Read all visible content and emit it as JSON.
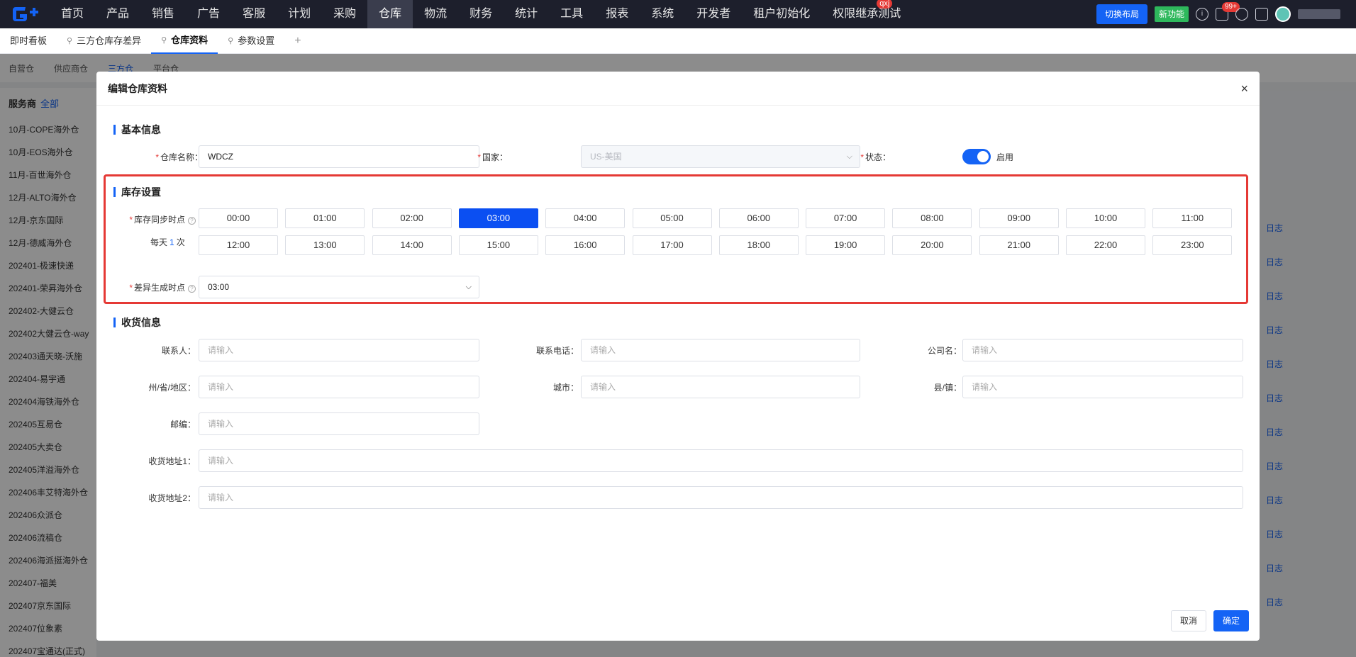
{
  "nav": {
    "items": [
      "首页",
      "产品",
      "销售",
      "广告",
      "客服",
      "计划",
      "采购",
      "仓库",
      "物流",
      "财务",
      "统计",
      "工具",
      "报表",
      "系统",
      "开发者",
      "租户初始化",
      "权限继承测试"
    ],
    "active_index": 7,
    "qxj_badge": "qxj",
    "switch_layout": "切换布局",
    "new_feature": "新功能",
    "notify_badge": "99+"
  },
  "tabs": {
    "items": [
      "即时看板",
      "三方仓库存差异",
      "仓库资料",
      "参数设置"
    ],
    "add": "+"
  },
  "subtabs": [
    "自营仓",
    "供应商仓",
    "三方仓",
    "平台仓"
  ],
  "sidebar": {
    "title": "服务商",
    "all": "全部",
    "items": [
      "10月-COPE海外仓",
      "10月-EOS海外仓",
      "11月-百世海外仓",
      "12月-ALTO海外仓",
      "12月-京东国际",
      "12月-德威海外仓",
      "202401-极速快递",
      "202401-荣昇海外仓",
      "202402-大健云仓",
      "202402大健云仓-way",
      "202403通天晓-沃施",
      "202404-易宇通",
      "202404海铁海外仓",
      "202405互易仓",
      "202405大卖仓",
      "202405洋溢海外仓",
      "202406丰艾特海外仓",
      "202406众派仓",
      "202406流稿仓",
      "202406海派挺海外仓",
      "202407-福美",
      "202407京东国际",
      "202407位象素",
      "202407宝通达(正式)"
    ]
  },
  "bg_log_label": "日志",
  "modal": {
    "title": "编辑仓库资料",
    "close": "×",
    "basic": {
      "section": "基本信息",
      "name_label": "仓库名称：",
      "name_value": "WDCZ",
      "country_label": "国家：",
      "country_value": "US-美国",
      "status_label": "状态：",
      "status_value": "启用"
    },
    "stock": {
      "section": "库存设置",
      "sync_label": "库存同步时点",
      "per_day_prefix": "每天",
      "per_day_count": "1",
      "per_day_suffix": "次",
      "times": [
        "00:00",
        "01:00",
        "02:00",
        "03:00",
        "04:00",
        "05:00",
        "06:00",
        "07:00",
        "08:00",
        "09:00",
        "10:00",
        "11:00",
        "12:00",
        "13:00",
        "14:00",
        "15:00",
        "16:00",
        "17:00",
        "18:00",
        "19:00",
        "20:00",
        "21:00",
        "22:00",
        "23:00"
      ],
      "selected_time": "03:00",
      "diff_label": "差异生成时点",
      "diff_value": "03:00"
    },
    "receive": {
      "section": "收货信息",
      "placeholder": "请输入",
      "contact_label": "联系人：",
      "phone_label": "联系电话：",
      "company_label": "公司名：",
      "state_label": "州/省/地区：",
      "city_label": "城市：",
      "county_label": "县/镇：",
      "zip_label": "邮编：",
      "addr1_label": "收货地址1：",
      "addr2_label": "收货地址2："
    },
    "footer": {
      "cancel": "取消",
      "ok": "确定"
    }
  }
}
